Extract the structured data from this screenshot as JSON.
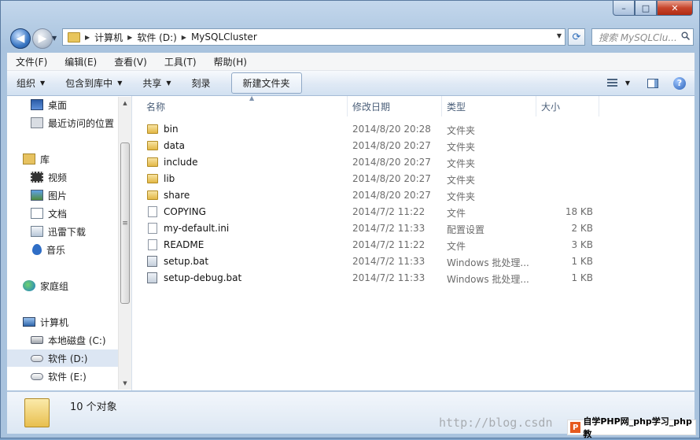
{
  "caption": {
    "minimize": "–",
    "maximize": "□",
    "close": "✕"
  },
  "address": {
    "crumbs": [
      "计算机",
      "软件 (D:)",
      "MySQLCluster"
    ]
  },
  "search": {
    "placeholder": "搜索 MySQLClu..."
  },
  "menubar": [
    "文件(F)",
    "编辑(E)",
    "查看(V)",
    "工具(T)",
    "帮助(H)"
  ],
  "toolbar": {
    "organize": "组织",
    "include_library": "包含到库中",
    "share": "共享",
    "burn": "刻录",
    "new_folder": "新建文件夹",
    "help": "?"
  },
  "navpane": {
    "items": [
      {
        "label": "桌面",
        "icon": "desktop-icon"
      },
      {
        "label": "最近访问的位置",
        "icon": "recent-places-icon"
      },
      {
        "label": "库",
        "icon": "libraries-icon"
      },
      {
        "label": "视频",
        "icon": "videos-icon"
      },
      {
        "label": "图片",
        "icon": "pictures-icon"
      },
      {
        "label": "文档",
        "icon": "documents-icon"
      },
      {
        "label": "迅雷下载",
        "icon": "thunder-download-icon"
      },
      {
        "label": "音乐",
        "icon": "music-icon"
      },
      {
        "label": "家庭组",
        "icon": "homegroup-icon"
      },
      {
        "label": "计算机",
        "icon": "computer-icon"
      },
      {
        "label": "本地磁盘 (C:)",
        "icon": "local-disk-icon"
      },
      {
        "label": "软件 (D:)",
        "icon": "drive-icon"
      },
      {
        "label": "软件 (E:)",
        "icon": "drive-icon"
      }
    ],
    "selected": "软件 (D:)"
  },
  "columns": {
    "name": "名称",
    "date": "修改日期",
    "type": "类型",
    "size": "大小"
  },
  "files": [
    {
      "name": "bin",
      "date": "2014/8/20 20:28",
      "type": "文件夹",
      "size": "",
      "icon": "folder-icon"
    },
    {
      "name": "data",
      "date": "2014/8/20 20:27",
      "type": "文件夹",
      "size": "",
      "icon": "folder-icon"
    },
    {
      "name": "include",
      "date": "2014/8/20 20:27",
      "type": "文件夹",
      "size": "",
      "icon": "folder-icon"
    },
    {
      "name": "lib",
      "date": "2014/8/20 20:27",
      "type": "文件夹",
      "size": "",
      "icon": "folder-icon"
    },
    {
      "name": "share",
      "date": "2014/8/20 20:27",
      "type": "文件夹",
      "size": "",
      "icon": "folder-icon"
    },
    {
      "name": "COPYING",
      "date": "2014/7/2 11:22",
      "type": "文件",
      "size": "18 KB",
      "icon": "file-icon"
    },
    {
      "name": "my-default.ini",
      "date": "2014/7/2 11:33",
      "type": "配置设置",
      "size": "2 KB",
      "icon": "ini-file-icon"
    },
    {
      "name": "README",
      "date": "2014/7/2 11:22",
      "type": "文件",
      "size": "3 KB",
      "icon": "file-icon"
    },
    {
      "name": "setup.bat",
      "date": "2014/7/2 11:33",
      "type": "Windows 批处理...",
      "size": "1 KB",
      "icon": "batch-file-icon"
    },
    {
      "name": "setup-debug.bat",
      "date": "2014/7/2 11:33",
      "type": "Windows 批处理...",
      "size": "1 KB",
      "icon": "batch-file-icon"
    }
  ],
  "status": {
    "count_text": "10 个对象"
  },
  "watermark": {
    "url": "http://blog.csdn",
    "badge": "自学PHP网_php学习_php教"
  }
}
